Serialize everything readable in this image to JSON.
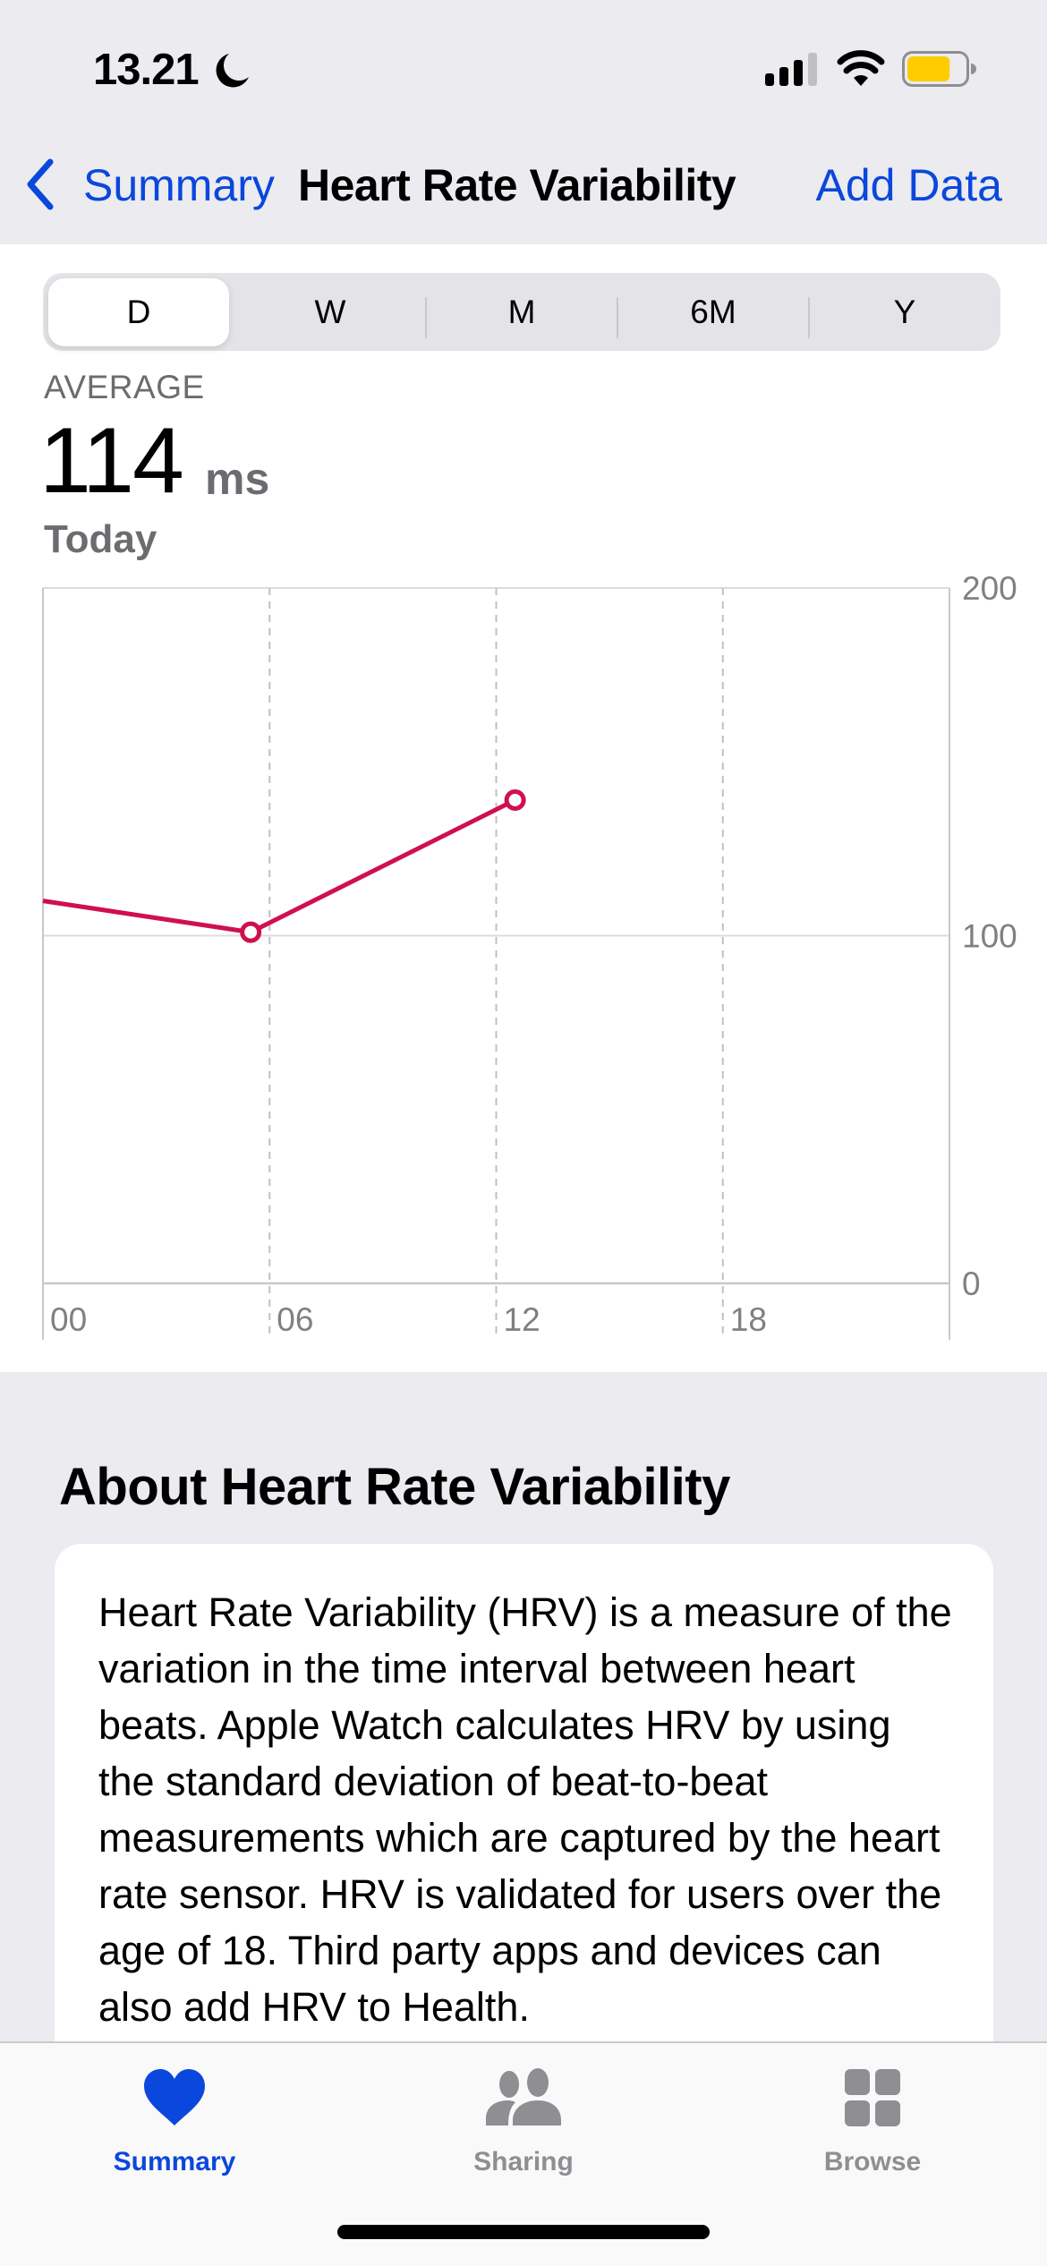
{
  "status_bar": {
    "time": "13.21",
    "focus_icon": "moon-icon",
    "signal_bars_active": 3,
    "signal_bars_total": 4,
    "battery_level": 0.75,
    "battery_color": "#ffcc00"
  },
  "nav": {
    "back_label": "Summary",
    "title": "Heart Rate Variability",
    "action_label": "Add Data",
    "accent": "#0a47dc"
  },
  "segmented": {
    "options": [
      "D",
      "W",
      "M",
      "6M",
      "Y"
    ],
    "selected": "D"
  },
  "summary": {
    "label": "AVERAGE",
    "value": "114",
    "unit": "ms",
    "period": "Today"
  },
  "chart_data": {
    "type": "line",
    "title": "",
    "xlabel": "",
    "ylabel": "ms",
    "x_unit": "hour of day",
    "xlim": [
      0,
      24
    ],
    "ylim": [
      0,
      200
    ],
    "x_ticks": [
      0,
      6,
      12,
      18
    ],
    "x_tick_labels": [
      "00",
      "06",
      "12",
      "18"
    ],
    "y_ticks": [
      0,
      100,
      200
    ],
    "y_tick_labels": [
      "0",
      "100",
      "200"
    ],
    "grid": true,
    "legend": "none",
    "line_color": "#d0104c",
    "series": [
      {
        "name": "HRV",
        "points": [
          {
            "x": 0,
            "y": 110,
            "marker": false
          },
          {
            "x": 5.5,
            "y": 101,
            "marker": true
          },
          {
            "x": 12.5,
            "y": 139,
            "marker": true
          }
        ]
      }
    ]
  },
  "about": {
    "heading": "About Heart Rate Variability",
    "body": "Heart Rate Variability (HRV) is a measure of the variation in the time interval between heart beats. Apple Watch calculates HRV by using the standard deviation of beat-to-beat measurements which are captured by the heart rate sensor. HRV is validated for users over the age of 18. Third party apps and devices can also add HRV to Health."
  },
  "tab_bar": {
    "items": [
      {
        "label": "Summary",
        "icon": "heart-icon",
        "active": true
      },
      {
        "label": "Sharing",
        "icon": "people-icon",
        "active": false
      },
      {
        "label": "Browse",
        "icon": "grid-icon",
        "active": false
      }
    ],
    "active_color": "#0a47dc",
    "inactive_color": "#8e8e93"
  }
}
